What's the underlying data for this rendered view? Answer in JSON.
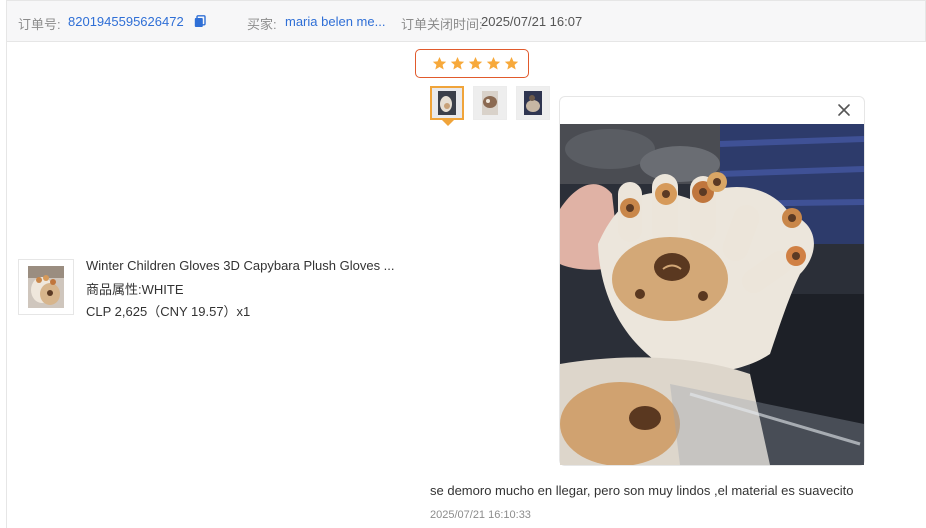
{
  "order": {
    "number_label": "订单号:",
    "number": "8201945595626472",
    "buyer_label": "买家:",
    "buyer": "maria belen me...",
    "closed_label": "订单关闭时间:",
    "closed_time": "2025/07/21 16:07"
  },
  "product": {
    "title": "Winter Children Gloves 3D Capybara Plush Gloves ...",
    "attr_label": "商品属性:",
    "attr_value": "WHITE",
    "price": "CLP 2,625（CNY  19.57）x1"
  },
  "review": {
    "rating": 5,
    "max_rating": 5,
    "text": "se demoro mucho en llegar, pero son muy lindos ,el material es suavecito",
    "time": "2025/07/21 16:10:33",
    "thumbnails": [
      {
        "name": "review-photo-1",
        "active": true
      },
      {
        "name": "review-photo-2",
        "active": false
      },
      {
        "name": "review-photo-3",
        "active": false
      }
    ]
  },
  "colors": {
    "link": "#2f6fd6",
    "star": "#f7a93b",
    "stars_border": "#e15a2c",
    "active_thumb": "#f0a43a"
  },
  "icons": [
    "copy-icon",
    "star-icon",
    "close-icon"
  ]
}
